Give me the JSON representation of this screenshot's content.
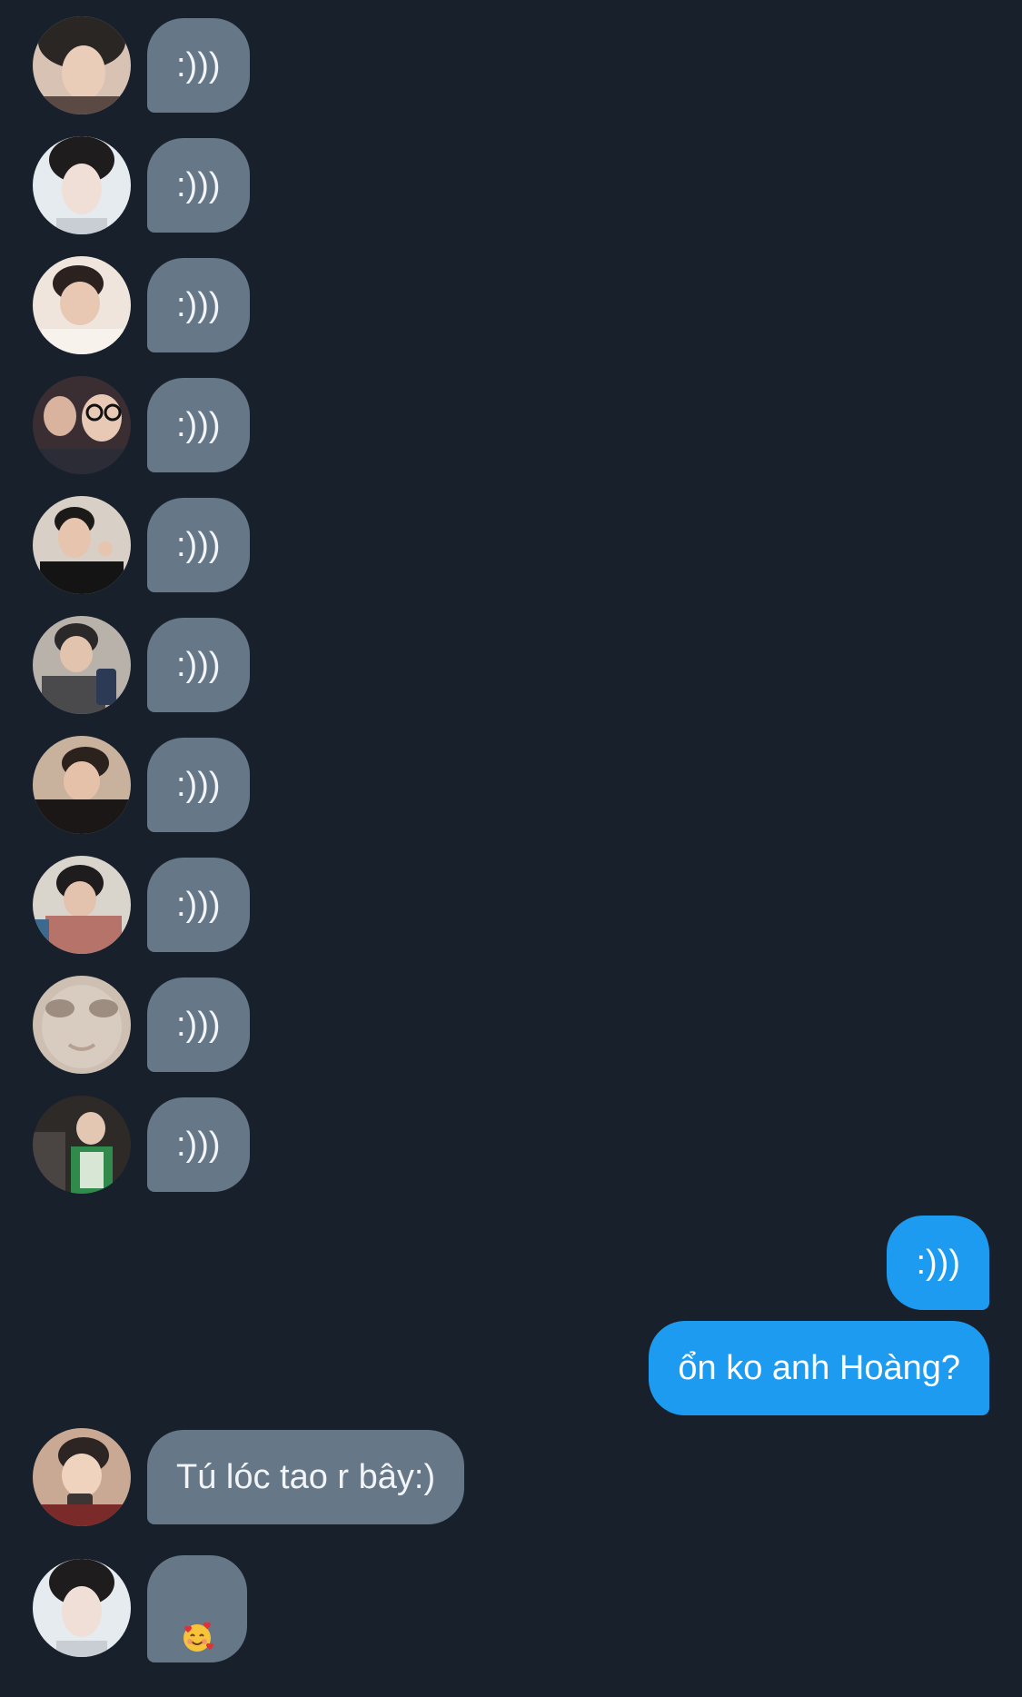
{
  "messages": [
    {
      "direction": "in",
      "text": ":)))",
      "avatar": "avatar-1"
    },
    {
      "direction": "in",
      "text": ":)))",
      "avatar": "avatar-2"
    },
    {
      "direction": "in",
      "text": ":)))",
      "avatar": "avatar-3"
    },
    {
      "direction": "in",
      "text": ":)))",
      "avatar": "avatar-4"
    },
    {
      "direction": "in",
      "text": ":)))",
      "avatar": "avatar-5"
    },
    {
      "direction": "in",
      "text": ":)))",
      "avatar": "avatar-6"
    },
    {
      "direction": "in",
      "text": ":)))",
      "avatar": "avatar-7"
    },
    {
      "direction": "in",
      "text": ":)))",
      "avatar": "avatar-8"
    },
    {
      "direction": "in",
      "text": ":)))",
      "avatar": "avatar-9"
    },
    {
      "direction": "in",
      "text": ":)))",
      "avatar": "avatar-10"
    },
    {
      "direction": "out",
      "text": ":)))"
    },
    {
      "direction": "out",
      "text": "ổn ko anh Hoàng?"
    },
    {
      "direction": "in",
      "text": "Tú lóc tao r bây:)",
      "avatar": "avatar-11"
    },
    {
      "direction": "in",
      "text": "",
      "emoji": "smiling-face-with-hearts-emoji",
      "avatar": "avatar-2"
    }
  ],
  "colors": {
    "background": "#18202b",
    "incoming_bubble": "#667788",
    "outgoing_bubble": "#1d9bf0"
  }
}
